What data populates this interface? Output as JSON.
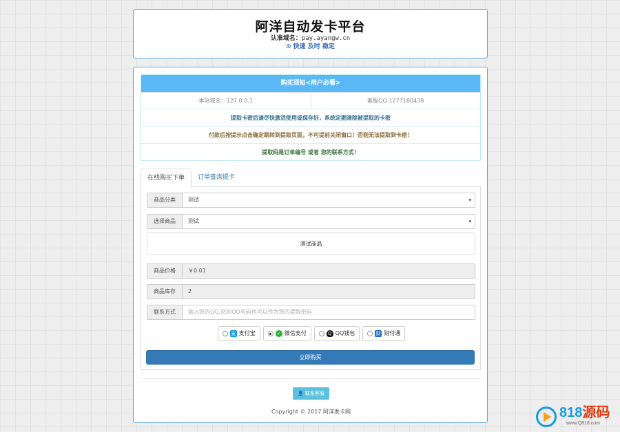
{
  "header": {
    "title": "阿洋自动发卡平台",
    "domain_label": "认准域名：",
    "domain_value": "pay.ayangw.cn",
    "slogan_icon": "⊙",
    "slogan": "快速 及时 稳定"
  },
  "notice": {
    "title": "购买须知<用户必看>",
    "site_domain": "本站域名：127.0.0.1",
    "service_qq": "客服QQ:1277180438",
    "line1": "提取卡密后请尽快激活使用或保存好，系统定期清除被提取的卡密",
    "line2": "付款后按提示点击确定跳转到提取页面，不可提前关闭窗口！否则无法提取到卡密！",
    "line3": "提取码是订单编号 或者 您的联系方式！",
    "colors": {
      "line1": "#31708f",
      "line2": "#8a6d3b",
      "line3": "#3c763d"
    }
  },
  "tabs": [
    {
      "label": "在线购买下单"
    },
    {
      "label": "订单查询提卡"
    }
  ],
  "form": {
    "category_label": "商品分类",
    "category_value": "测试",
    "product_label": "选择商品",
    "product_value": "测试",
    "product_desc": "测试商品",
    "price_label": "商品价格",
    "price_value": "￥0.01",
    "stock_label": "商品库存",
    "stock_value": "2",
    "contact_label": "联系方式",
    "contact_placeholder": "输入您的QQ,您的QQ号码也可以作为您的提取密码",
    "select_caret": "▾"
  },
  "payment": {
    "options": [
      {
        "label": "支付宝",
        "icon": "alipay-icon",
        "color": "#1a9be6",
        "selected": false
      },
      {
        "label": "微信支付",
        "icon": "wechat-icon",
        "color": "#2aae3a",
        "selected": true
      },
      {
        "label": "QQ钱包",
        "icon": "qq-icon",
        "color": "#111111",
        "selected": false
      },
      {
        "label": "财付通",
        "icon": "tenpay-icon",
        "color": "#1f6fc5",
        "selected": false
      }
    ]
  },
  "buy_button": "立即购买",
  "contact_button": "联系客服",
  "copyright": "Copyright © 2017 阿洋发卡网",
  "watermark": {
    "main": "818",
    "accent": "源码",
    "sub": "www.Q818.com"
  }
}
